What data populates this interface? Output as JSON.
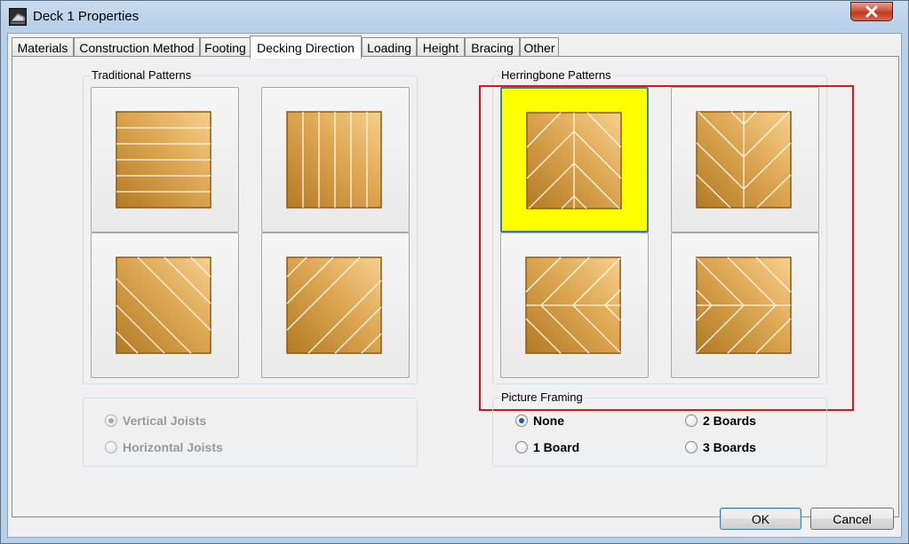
{
  "window": {
    "title": "Deck 1 Properties",
    "close_icon": "close-x-icon"
  },
  "tabs": [
    {
      "label": "Materials",
      "active": false
    },
    {
      "label": "Construction Method",
      "active": false
    },
    {
      "label": "Footing",
      "active": false
    },
    {
      "label": "Decking Direction",
      "active": true
    },
    {
      "label": "Loading",
      "active": false
    },
    {
      "label": "Height",
      "active": false
    },
    {
      "label": "Bracing",
      "active": false
    },
    {
      "label": "Other",
      "active": false
    }
  ],
  "traditional": {
    "label": "Traditional Patterns",
    "patterns": [
      "horizontal-boards",
      "vertical-boards",
      "diagonal-down-right",
      "diagonal-up-right"
    ]
  },
  "herringbone": {
    "label": "Herringbone Patterns",
    "patterns": [
      "herringbone-vertical-down",
      "herringbone-vertical-up",
      "herringbone-horizontal-left",
      "herringbone-horizontal-right"
    ],
    "selected_index": 0
  },
  "joists": {
    "vertical_label": "Vertical Joists",
    "horizontal_label": "Horizontal Joists",
    "selected": "vertical",
    "enabled": false
  },
  "picture_framing": {
    "label": "Picture Framing",
    "options": [
      "None",
      "1 Board",
      "2 Boards",
      "3 Boards"
    ],
    "selected": "None"
  },
  "buttons": {
    "ok": "OK",
    "cancel": "Cancel"
  },
  "colors": {
    "wood_light": "#f6d18e",
    "wood_dark": "#b27a24",
    "selection": "#ffff00",
    "highlight_border": "#e0141b"
  }
}
